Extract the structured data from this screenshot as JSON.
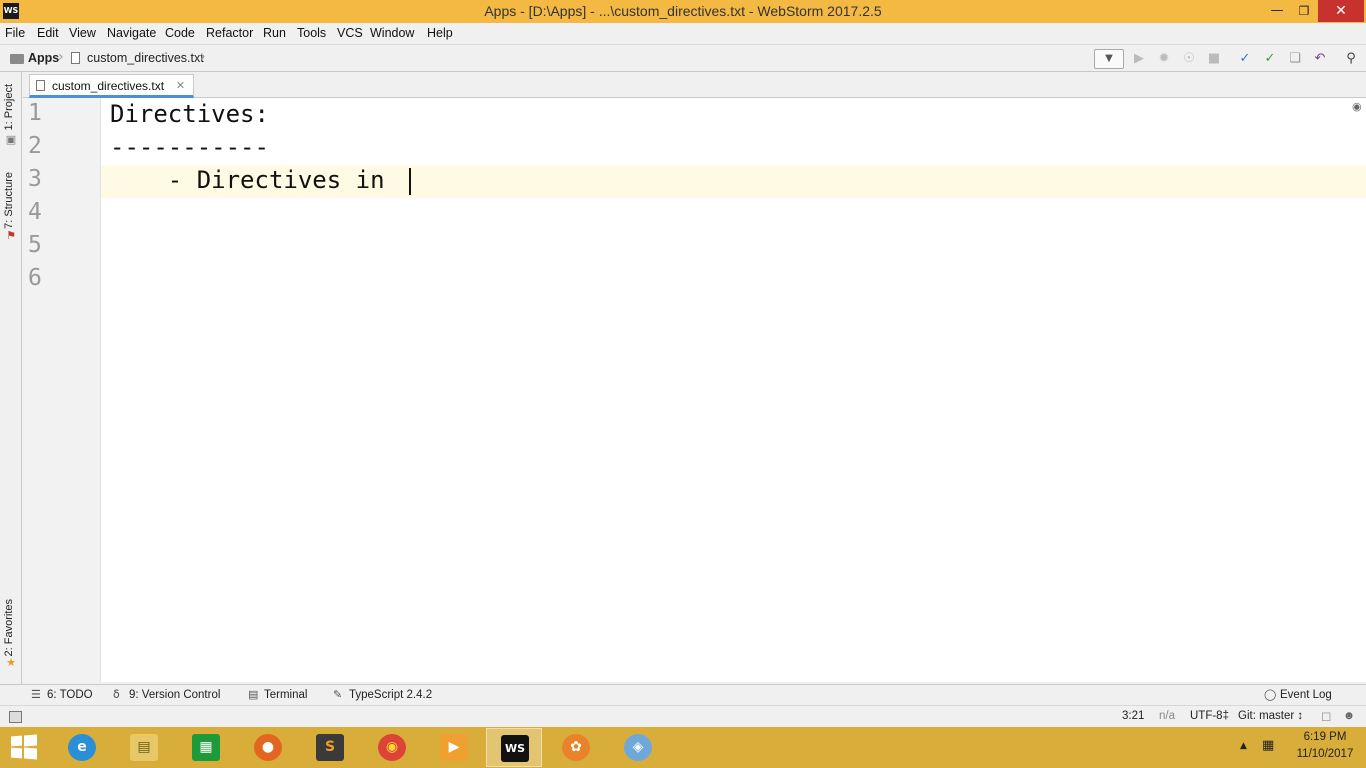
{
  "window": {
    "app_icon": "WS",
    "title": "Apps - [D:\\Apps] - ...\\custom_directives.txt - WebStorm 2017.2.5",
    "controls": [
      "minimize-icon",
      "maximize-icon",
      "close-icon"
    ]
  },
  "menu": [
    "File",
    "Edit",
    "View",
    "Navigate",
    "Code",
    "Refactor",
    "Run",
    "Tools",
    "VCS",
    "Window",
    "Help"
  ],
  "navbar": {
    "project": "Apps",
    "file": "custom_directives.txt",
    "toolbar_icons": [
      "run-icon",
      "debug-icon",
      "coverage-icon",
      "stop-icon",
      "vcs-update-icon",
      "vcs-commit-icon",
      "compare-icon",
      "revert-icon",
      "search-icon"
    ]
  },
  "left_tool_windows": [
    "1: Project",
    "7: Structure",
    "2: Favorites"
  ],
  "editor": {
    "tab": "custom_directives.txt",
    "line_numbers": [
      "1",
      "2",
      "3",
      "4",
      "5",
      "6"
    ],
    "lines": [
      "Directives:",
      "-----------",
      "    - Directives in "
    ],
    "caret_line": 3
  },
  "bottom_tools": {
    "todo": "6: TODO",
    "version_control": "9: Version Control",
    "terminal": "Terminal",
    "typescript": "TypeScript 2.4.2",
    "event_log": "Event Log"
  },
  "status": {
    "position": "3:21",
    "na": "n/a",
    "encoding": "UTF-8‡",
    "git": "Git: master ↕"
  },
  "taskbar": {
    "apps": [
      "internet-explorer",
      "file-explorer",
      "windows-store",
      "firefox",
      "sublime-text",
      "chrome",
      "media-player",
      "webstorm",
      "flower-app",
      "paint"
    ],
    "active_app": "webstorm",
    "time": "6:19 PM",
    "date": "11/10/2017"
  },
  "colors": {
    "title_bar": "#f4b942",
    "close_button": "#c7322f",
    "caret_line": "#fffae3",
    "taskbar": "#d9ad3a",
    "tab_underline": "#4d8fd6"
  }
}
